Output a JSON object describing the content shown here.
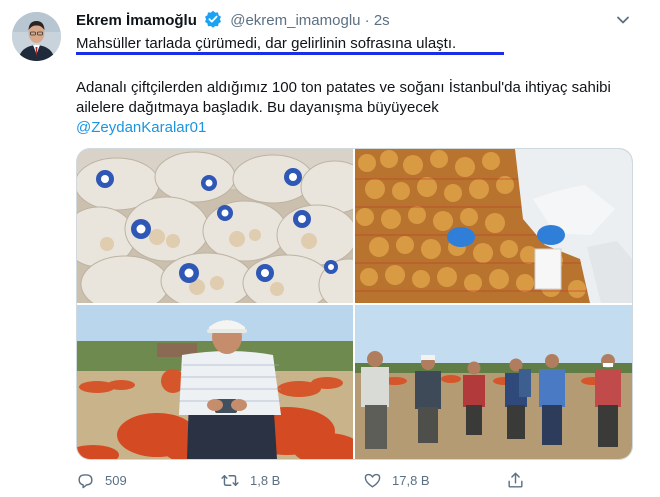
{
  "author": {
    "name": "Ekrem İmamoğlu",
    "handle": "@ekrem_imamoglu",
    "separator": "·",
    "time": "2s"
  },
  "tweet": {
    "line1": "Mahsüller tarlada çürümedi, dar gelirlinin sofrasına ulaştı.",
    "body": "Adanalı çiftçilerden aldığımız 100 ton patates ve soğanı İstanbul'da ihtiyaç sahibi ailelere dağıtmaya başladık. Bu dayanışma büyüyecek",
    "mention": "@ZeydanKaralar01"
  },
  "actions": {
    "reply_count": "509",
    "retweet_count": "1,8 B",
    "like_count": "17,8 B"
  },
  "colors": {
    "accent": "#1b95e0",
    "underline": "#1a2ee8",
    "muted": "#5b7083"
  },
  "icons": [
    "verified-badge-icon",
    "chevron-down-icon",
    "reply-icon",
    "retweet-icon",
    "like-icon",
    "share-icon"
  ]
}
